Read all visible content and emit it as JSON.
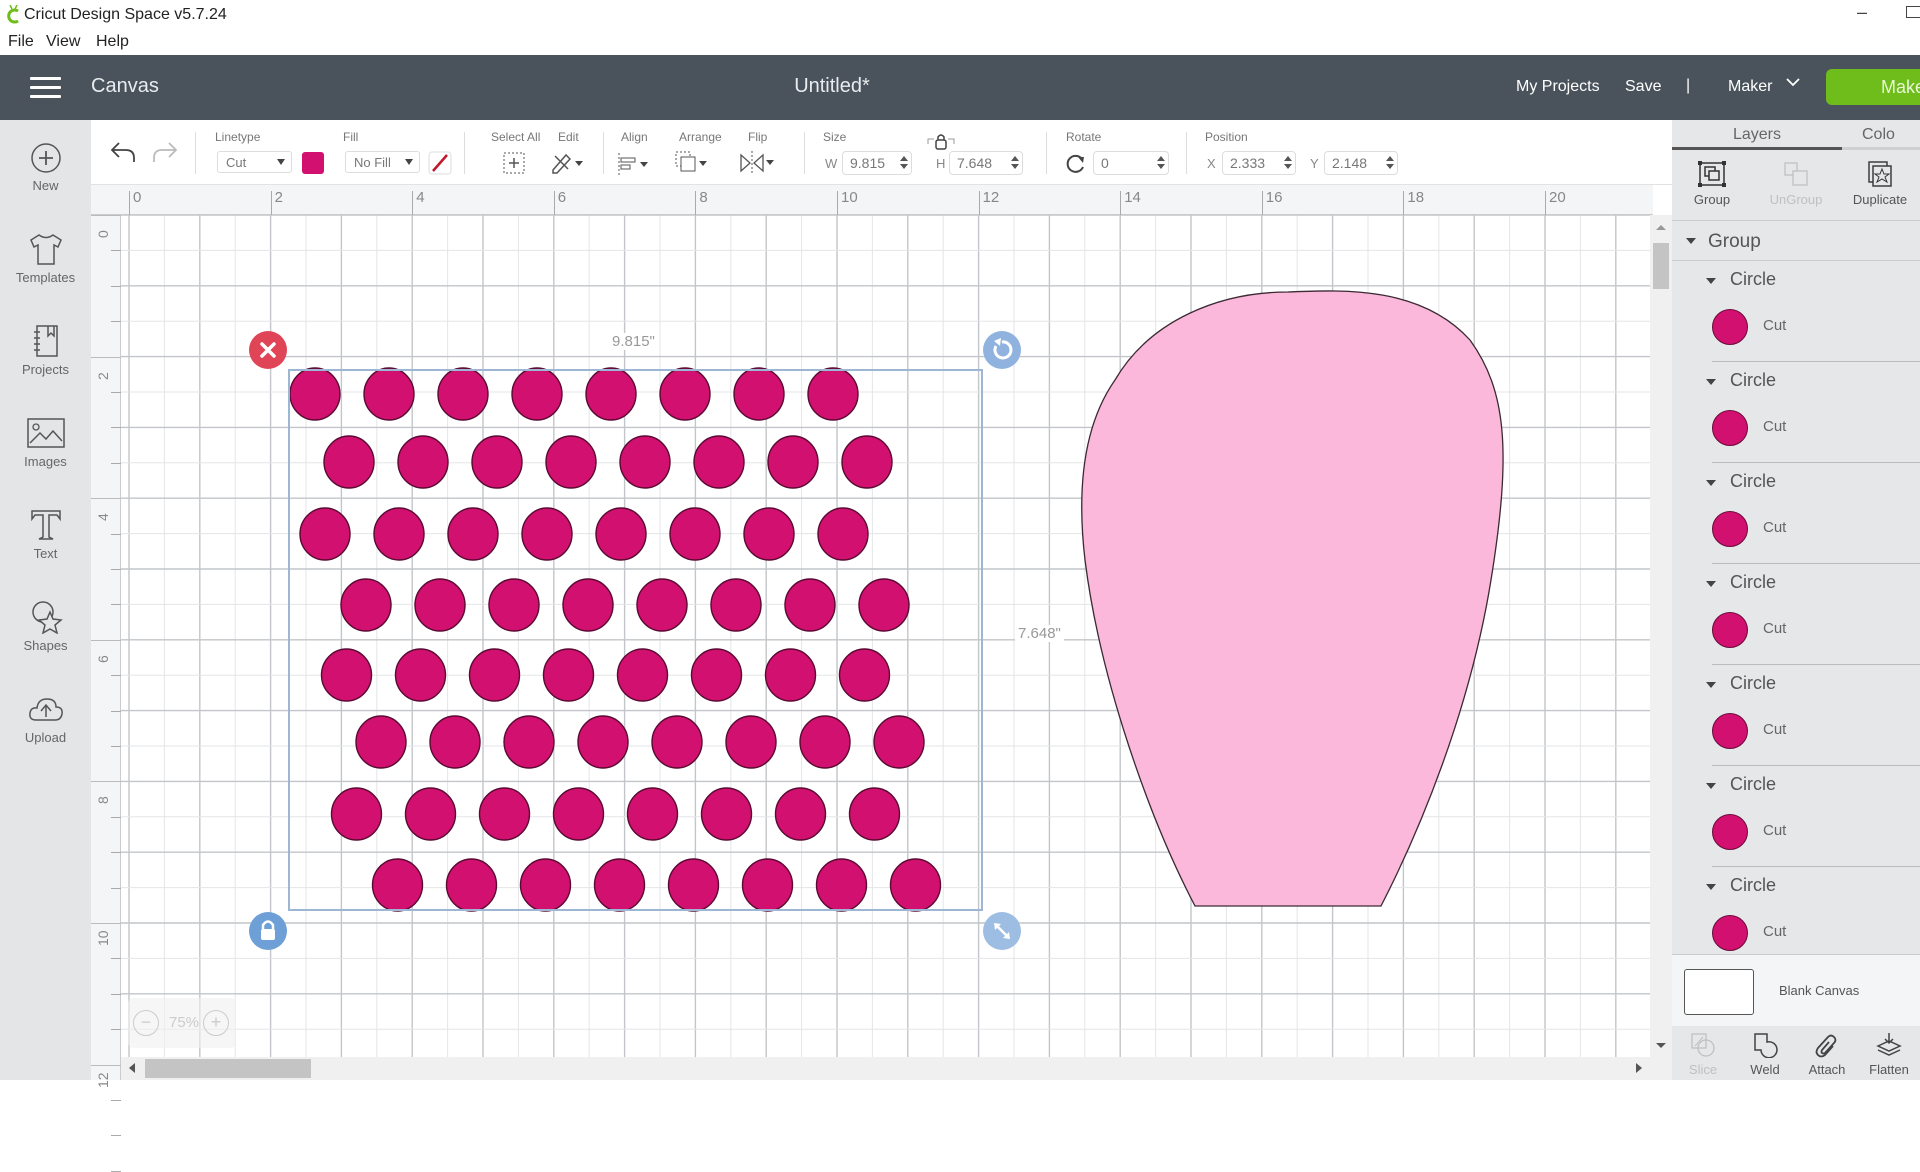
{
  "window": {
    "title": "Cricut Design Space  v5.7.24",
    "minimize_glyph": "–",
    "logo_color": "#6fbd1b"
  },
  "menu": [
    "File",
    "View",
    "Help"
  ],
  "header": {
    "section": "Canvas",
    "document_title": "Untitled*",
    "my_projects": "My Projects",
    "save": "Save",
    "separator": "|",
    "machine": "Maker",
    "make": "Make It",
    "make_visible": "Make",
    "bg_color": "#4a535b",
    "make_color": "#6fbd1b"
  },
  "sidebar": {
    "items": [
      {
        "label": "New",
        "icon": "plus-circle-icon"
      },
      {
        "label": "Templates",
        "icon": "tshirt-icon"
      },
      {
        "label": "Projects",
        "icon": "notebook-icon"
      },
      {
        "label": "Images",
        "icon": "image-icon"
      },
      {
        "label": "Text",
        "icon": "text-icon"
      },
      {
        "label": "Shapes",
        "icon": "shapes-icon"
      },
      {
        "label": "Upload",
        "icon": "cloud-upload-icon"
      }
    ]
  },
  "toolbar": {
    "linetype_label": "Linetype",
    "linetype_value": "Cut",
    "linetype_color": "#d1106f",
    "fill_label": "Fill",
    "fill_value": "No Fill",
    "select_all_label": "Select All",
    "edit_label": "Edit",
    "align_label": "Align",
    "arrange_label": "Arrange",
    "flip_label": "Flip",
    "size_label": "Size",
    "w_label": "W",
    "w_value": "9.815",
    "h_label": "H",
    "h_value": "7.648",
    "rotate_label": "Rotate",
    "rotate_value": "0",
    "position_label": "Position",
    "x_label": "X",
    "x_value": "2.333",
    "y_label": "Y",
    "y_value": "2.148"
  },
  "rulers": {
    "horizontal": [
      "0",
      "2",
      "4",
      "6",
      "8",
      "10",
      "12",
      "14",
      "16",
      "18",
      "20"
    ],
    "vertical": [
      "0",
      "2",
      "4",
      "6",
      "8",
      "10",
      "12"
    ]
  },
  "canvas": {
    "zoom_level": "75%",
    "selection_width_label": "9.815\"",
    "selection_height_label": "7.648\"",
    "dot_color": "#d1106f",
    "dot_stroke": "#5a0a33",
    "dot_rows": [
      {
        "offset": 0.0,
        "count": 8
      },
      {
        "offset": 0.68,
        "count": 8
      },
      {
        "offset": 0.2,
        "count": 8
      },
      {
        "offset": 1.02,
        "count": 8
      },
      {
        "offset": 0.63,
        "count": 8
      },
      {
        "offset": 1.32,
        "count": 8
      },
      {
        "offset": 0.83,
        "count": 8
      },
      {
        "offset": 1.65,
        "count": 8
      }
    ],
    "shape_fill": "#fbb8da",
    "shape_name": "petal"
  },
  "layers_panel": {
    "tabs": [
      "Layers",
      "Color Sync"
    ],
    "tab_colors_visible": "Colo",
    "actions": [
      {
        "label": "Group",
        "enabled": true
      },
      {
        "label": "UnGroup",
        "enabled": false
      },
      {
        "label": "Duplicate",
        "enabled": true
      }
    ],
    "group_name": "Group",
    "layers": [
      {
        "name": "Circle",
        "operation": "Cut"
      },
      {
        "name": "Circle",
        "operation": "Cut"
      },
      {
        "name": "Circle",
        "operation": "Cut"
      },
      {
        "name": "Circle",
        "operation": "Cut"
      },
      {
        "name": "Circle",
        "operation": "Cut"
      },
      {
        "name": "Circle",
        "operation": "Cut"
      },
      {
        "name": "Circle",
        "operation": "Cut"
      }
    ],
    "blank_canvas_label": "Blank Canvas",
    "bottom_actions": [
      {
        "label": "Slice",
        "enabled": false
      },
      {
        "label": "Weld",
        "enabled": true
      },
      {
        "label": "Attach",
        "enabled": true
      },
      {
        "label": "Flatten",
        "enabled": true
      }
    ]
  }
}
